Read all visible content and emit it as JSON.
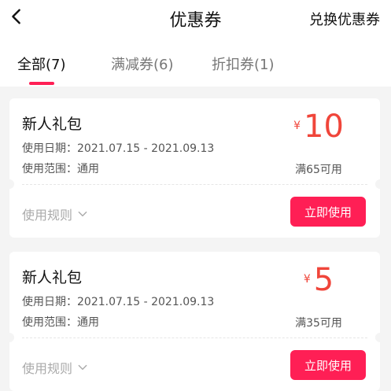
{
  "header": {
    "title": "优惠券",
    "exchange_label": "兑换优惠券",
    "back_icon": "chevron-left-icon"
  },
  "tabs": [
    {
      "label": "全部(7)",
      "active": true
    },
    {
      "label": "满减券(6)",
      "active": false
    },
    {
      "label": "折扣券(1)",
      "active": false
    }
  ],
  "colors": {
    "accent": "#ff1f55",
    "price": "#f0453a",
    "background": "#f4f4f4"
  },
  "coupons": [
    {
      "name": "新人礼包",
      "date_label": "使用日期：2021.07.15 - 2021.09.13",
      "scope_label": "使用范围：通用",
      "currency": "¥",
      "amount": "10",
      "condition": "满65可用",
      "rules_label": "使用规则",
      "use_label": "立即使用"
    },
    {
      "name": "新人礼包",
      "date_label": "使用日期：2021.07.15 - 2021.09.13",
      "scope_label": "使用范围：通用",
      "currency": "¥",
      "amount": "5",
      "condition": "满35可用",
      "rules_label": "使用规则",
      "use_label": "立即使用"
    }
  ]
}
